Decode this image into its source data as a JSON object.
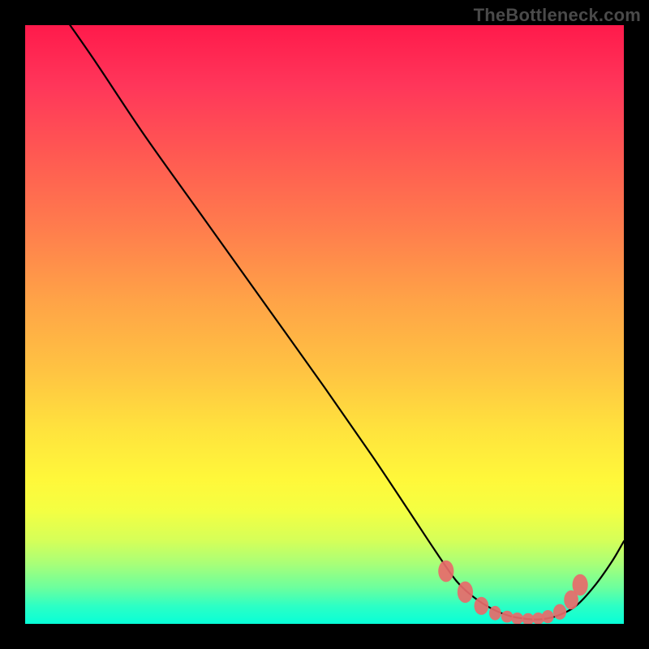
{
  "watermark": "TheBottleneck.com",
  "colors": {
    "page_bg": "#000000",
    "curve": "#000000",
    "bead": "#e86a6a"
  },
  "chart_data": {
    "type": "line",
    "title": "",
    "xlabel": "",
    "ylabel": "",
    "xlim": [
      0,
      1
    ],
    "ylim": [
      0,
      1
    ],
    "grid": false,
    "legend": false,
    "series": [
      {
        "name": "curve",
        "x": [
          0.075,
          0.12,
          0.2,
          0.3,
          0.4,
          0.5,
          0.58,
          0.64,
          0.685,
          0.72,
          0.75,
          0.78,
          0.81,
          0.84,
          0.865,
          0.89,
          0.92,
          0.95,
          0.98,
          1.0
        ],
        "y": [
          1.0,
          0.935,
          0.815,
          0.675,
          0.535,
          0.395,
          0.28,
          0.19,
          0.122,
          0.072,
          0.044,
          0.025,
          0.013,
          0.008,
          0.008,
          0.014,
          0.03,
          0.062,
          0.104,
          0.138
        ]
      }
    ],
    "beads": [
      {
        "x": 0.703,
        "y": 0.088,
        "rx": 0.013,
        "ry": 0.018
      },
      {
        "x": 0.735,
        "y": 0.053,
        "rx": 0.013,
        "ry": 0.018
      },
      {
        "x": 0.762,
        "y": 0.03,
        "rx": 0.012,
        "ry": 0.015
      },
      {
        "x": 0.785,
        "y": 0.018,
        "rx": 0.01,
        "ry": 0.012
      },
      {
        "x": 0.805,
        "y": 0.012,
        "rx": 0.01,
        "ry": 0.01
      },
      {
        "x": 0.822,
        "y": 0.009,
        "rx": 0.01,
        "ry": 0.01
      },
      {
        "x": 0.84,
        "y": 0.008,
        "rx": 0.01,
        "ry": 0.01
      },
      {
        "x": 0.857,
        "y": 0.009,
        "rx": 0.01,
        "ry": 0.01
      },
      {
        "x": 0.873,
        "y": 0.012,
        "rx": 0.01,
        "ry": 0.011
      },
      {
        "x": 0.893,
        "y": 0.02,
        "rx": 0.011,
        "ry": 0.013
      },
      {
        "x": 0.912,
        "y": 0.04,
        "rx": 0.012,
        "ry": 0.016
      },
      {
        "x": 0.927,
        "y": 0.065,
        "rx": 0.013,
        "ry": 0.018
      }
    ]
  }
}
